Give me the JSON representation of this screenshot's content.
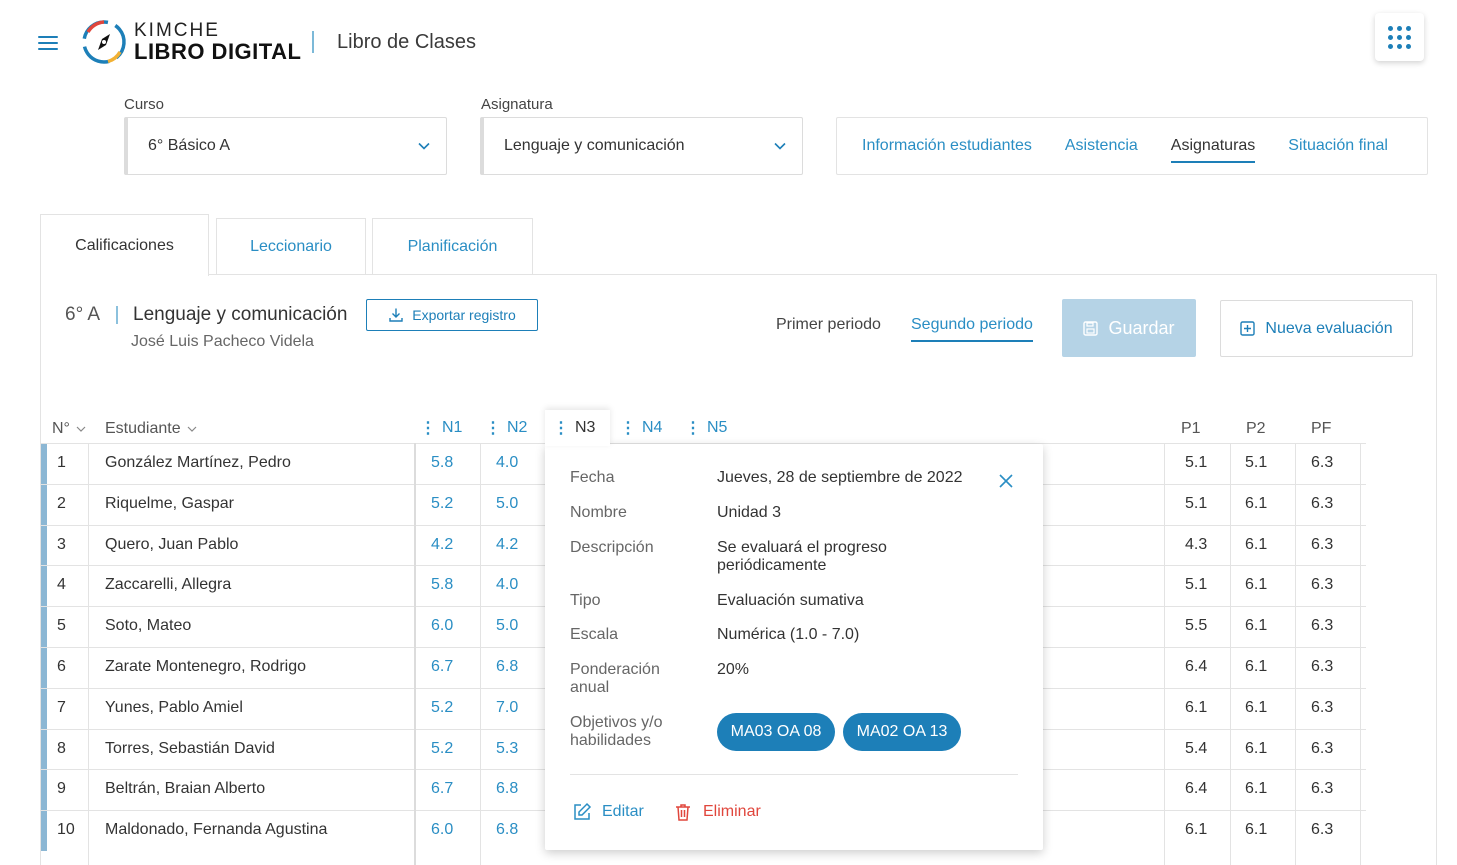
{
  "header": {
    "logo_top": "KIMCHE",
    "logo_bottom": "LIBRO DIGITAL",
    "title": "Libro de Clases",
    "apps_icon": "apps-grid-icon"
  },
  "filters": {
    "course_label": "Curso",
    "course_value": "6° Básico A",
    "subject_label": "Asignatura",
    "subject_value": "Lenguaje y comunicación"
  },
  "top_nav": {
    "items": [
      "Información estudiantes",
      "Asistencia",
      "Asignaturas",
      "Situación final"
    ],
    "active": "Asignaturas"
  },
  "tabs": {
    "items": [
      "Calificaciones",
      "Leccionario",
      "Planificación"
    ],
    "active": "Calificaciones"
  },
  "panel": {
    "course_code": "6° A",
    "subject": "Lenguaje y comunicación",
    "teacher": "José Luis Pacheco Videla",
    "export_label": "Exportar registro",
    "period_1": "Primer periodo",
    "period_2": "Segundo periodo",
    "save_label": "Guardar",
    "new_eval_label": "Nueva evaluación"
  },
  "table": {
    "col_num": "N°",
    "col_student": "Estudiante",
    "grade_cols": [
      "N1",
      "N2",
      "N3",
      "N4",
      "N5"
    ],
    "summary_cols": [
      "P1",
      "P2",
      "PF"
    ],
    "rows": [
      {
        "n": "1",
        "name": "González Martínez, Pedro",
        "n1": "5.8",
        "n2": "4.0",
        "p1": "5.1",
        "p2": "5.1",
        "pf": "6.3"
      },
      {
        "n": "2",
        "name": "Riquelme, Gaspar",
        "n1": "5.2",
        "n2": "5.0",
        "p1": "5.1",
        "p2": "6.1",
        "pf": "6.3"
      },
      {
        "n": "3",
        "name": "Quero, Juan Pablo",
        "n1": "4.2",
        "n2": "4.2",
        "p1": "4.3",
        "p2": "6.1",
        "pf": "6.3"
      },
      {
        "n": "4",
        "name": "Zaccarelli, Allegra",
        "n1": "5.8",
        "n2": "4.0",
        "p1": "5.1",
        "p2": "6.1",
        "pf": "6.3"
      },
      {
        "n": "5",
        "name": "Soto, Mateo",
        "n1": "6.0",
        "n2": "5.0",
        "p1": "5.5",
        "p2": "6.1",
        "pf": "6.3"
      },
      {
        "n": "6",
        "name": "Zarate Montenegro, Rodrigo",
        "n1": "6.7",
        "n2": "6.8",
        "p1": "6.4",
        "p2": "6.1",
        "pf": "6.3"
      },
      {
        "n": "7",
        "name": "Yunes, Pablo Amiel",
        "n1": "5.2",
        "n2": "7.0",
        "p1": "6.1",
        "p2": "6.1",
        "pf": "6.3"
      },
      {
        "n": "8",
        "name": "Torres, Sebastián David",
        "n1": "5.2",
        "n2": "5.3",
        "p1": "5.4",
        "p2": "6.1",
        "pf": "6.3"
      },
      {
        "n": "9",
        "name": "Beltrán, Braian Alberto",
        "n1": "6.7",
        "n2": "6.8",
        "p1": "6.4",
        "p2": "6.1",
        "pf": "6.3"
      },
      {
        "n": "10",
        "name": "Maldonado, Fernanda Agustina",
        "n1": "6.0",
        "n2": "6.8",
        "p1": "6.1",
        "p2": "6.1",
        "pf": "6.3"
      }
    ]
  },
  "popover": {
    "fecha_label": "Fecha",
    "fecha_value": "Jueves, 28 de septiembre de 2022",
    "nombre_label": "Nombre",
    "nombre_value": "Unidad 3",
    "descripcion_label": "Descripción",
    "descripcion_line1": "Se evaluará el progreso",
    "descripcion_line2": "periódicamente",
    "tipo_label": "Tipo",
    "tipo_value": "Evaluación sumativa",
    "escala_label": "Escala",
    "escala_value": "Numérica (1.0 - 7.0)",
    "ponderacion_label_1": "Ponderación",
    "ponderacion_label_2": "anual",
    "ponderacion_value": "20%",
    "objetivos_label_1": "Objetivos y/o",
    "objetivos_label_2": "habilidades",
    "chips": [
      "MA03 OA 08",
      "MA02 OA 13"
    ],
    "edit_label": "Editar",
    "delete_label": "Eliminar"
  },
  "colors": {
    "accent": "#1d7fb8",
    "link": "#2a8ec4",
    "danger": "#e0463c",
    "disabled_button": "#b5d3e6"
  }
}
